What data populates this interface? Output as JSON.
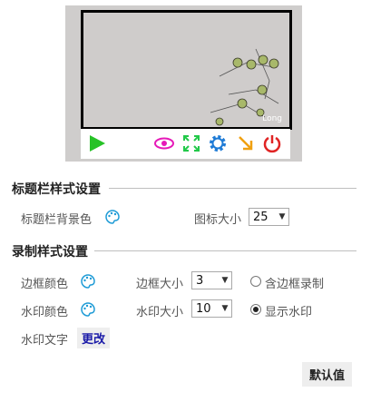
{
  "preview": {
    "watermark_text": "Long",
    "toolbar": {
      "play_icon": "play-icon",
      "eye_icon": "eye-icon",
      "fullscreen_icon": "fullscreen-icon",
      "settings_icon": "gear-icon",
      "minimize_icon": "arrow-down-right-icon",
      "power_icon": "power-icon"
    },
    "colors": {
      "frame_bg": "#cfcdcc",
      "play": "#27c227",
      "eye": "#e619b8",
      "fullscreen": "#23c94a",
      "gear": "#1e7bd6",
      "arrow": "#f0a010",
      "power": "#e02424"
    }
  },
  "titlebar_section": {
    "title": "标题栏样式设置",
    "bg_color_label": "标题栏背景色",
    "icon_size_label": "图标大小",
    "icon_size_value": "25"
  },
  "record_section": {
    "title": "录制样式设置",
    "border_color_label": "边框颜色",
    "border_size_label": "边框大小",
    "border_size_value": "3",
    "include_border_label": "含边框录制",
    "include_border_checked": false,
    "watermark_color_label": "水印颜色",
    "watermark_size_label": "水印大小",
    "watermark_size_value": "10",
    "show_watermark_label": "显示水印",
    "show_watermark_checked": true,
    "watermark_text_label": "水印文字",
    "change_button": "更改"
  },
  "default_button": "默认值"
}
